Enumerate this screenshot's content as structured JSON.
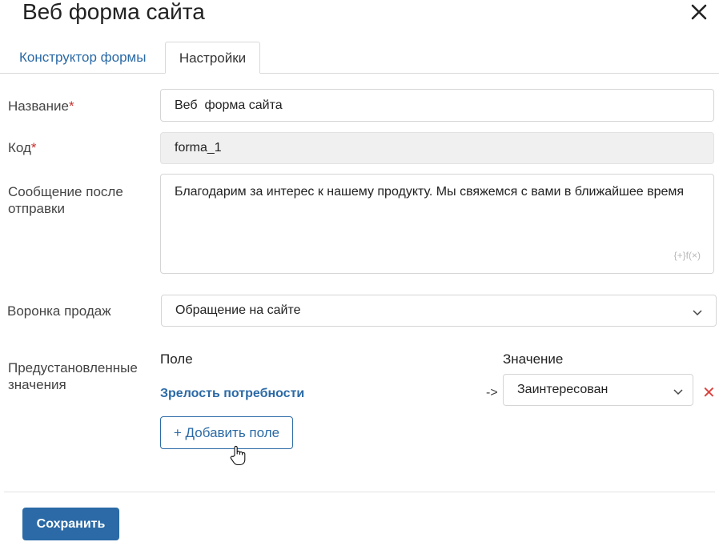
{
  "dialog": {
    "title": "Веб форма сайта"
  },
  "tabs": [
    {
      "label": "Конструктор формы",
      "active": false
    },
    {
      "label": "Настройки",
      "active": true
    }
  ],
  "fields": {
    "name": {
      "label": "Название",
      "required_mark": "*",
      "value": "Веб  форма сайта"
    },
    "code": {
      "label": "Код",
      "required_mark": "*",
      "value": "forma_1"
    },
    "message": {
      "label": "Сообщение после отправки",
      "value": "Благодарим за интерес к нашему продукту. Мы свяжемся с вами в ближайшее время",
      "formula_hint": "{+}f(×)"
    },
    "funnel": {
      "label": "Воронка продаж",
      "value": "Обращение на сайте"
    },
    "preset": {
      "label": "Предустановленные значения",
      "col_field": "Поле",
      "col_value": "Значение",
      "rows": [
        {
          "field": "Зрелость потребности",
          "arrow": "->",
          "value": "Заинтересован"
        }
      ],
      "add_label": "+ Добавить поле"
    }
  },
  "footer": {
    "save_label": "Сохранить"
  },
  "colors": {
    "accent": "#2b6aa6",
    "required": "#c9302c",
    "remove": "#d9433f"
  }
}
